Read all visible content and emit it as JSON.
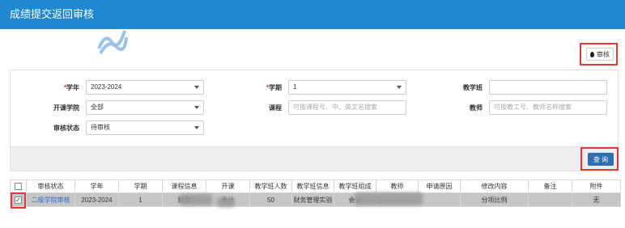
{
  "header": {
    "title": "成绩提交返回审核"
  },
  "toolbar": {
    "review_label": "审核",
    "review_icon": "drop-icon"
  },
  "form": {
    "year_label": "学年",
    "year_value": "2023-2024",
    "term_label": "学期",
    "term_value": "1",
    "class_label": "教学班",
    "class_value": "",
    "college_label": "开课学院",
    "college_value": "全部",
    "course_label": "课程",
    "course_placeholder": "可按课程号、中、英文名搜索",
    "teacher_label": "教师",
    "teacher_placeholder": "可按教工号、教师名称搜索",
    "status_label": "审核状态",
    "status_value": "待审核",
    "required_mark": "*"
  },
  "query": {
    "label": "查 询"
  },
  "table": {
    "headers": [
      "审核状态",
      "学年",
      "学期",
      "课程信息",
      "开课",
      "教学班人数",
      "教学班信息",
      "教学班组成",
      "教师",
      "申请原因",
      "修改内容",
      "备注",
      "附件"
    ],
    "row": {
      "status": "二级学院审核",
      "year": "2023-2024",
      "term": "1",
      "course": "财务",
      "college": "会计",
      "count": "50",
      "class_info": "财务管理实验",
      "composition": "会计",
      "teacher": "",
      "reason": "",
      "change": "分项比例",
      "remark": "",
      "attachment": "无",
      "checkmark": "✓"
    }
  },
  "colors": {
    "header_bg": "#1e88d2",
    "primary": "#2e6fb3",
    "highlight": "#e53935",
    "selected_row": "#c6c6c6"
  }
}
